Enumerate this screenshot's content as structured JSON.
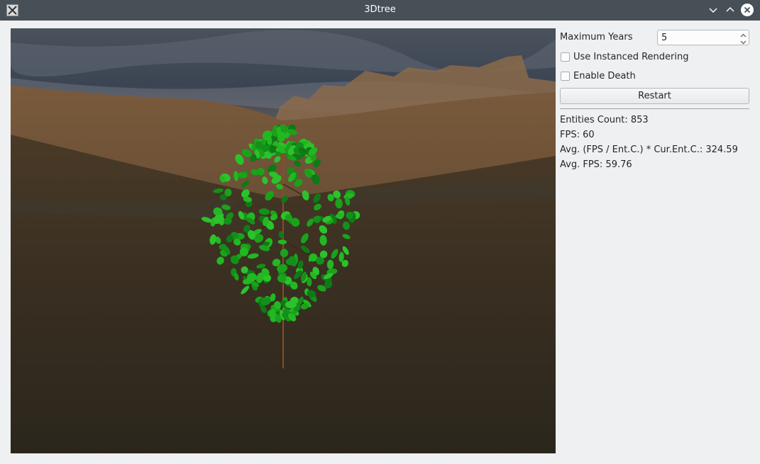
{
  "window": {
    "title": "3Dtree",
    "icon": "x-app-icon",
    "controls": [
      "minimize-icon",
      "maximize-icon",
      "close-icon"
    ]
  },
  "viewport": {
    "description_icon": "3d-scene",
    "colors": {
      "sky": "#3a4250",
      "ground": "#3b3021",
      "leaf": "#1aa31a",
      "trunk": "#8b4d22"
    }
  },
  "controls": {
    "max_years_label": "Maximum Years",
    "max_years_value": "5",
    "instanced_label": "Use Instanced Rendering",
    "instanced_checked": false,
    "death_label": "Enable Death",
    "death_checked": false,
    "restart_label": "Restart"
  },
  "stats": {
    "entities": "Entities Count: 853",
    "fps": "FPS: 60",
    "ratio": "Avg. (FPS / Ent.C.) * Cur.Ent.C.: 324.59",
    "avg_fps": "Avg. FPS: 59.76"
  }
}
